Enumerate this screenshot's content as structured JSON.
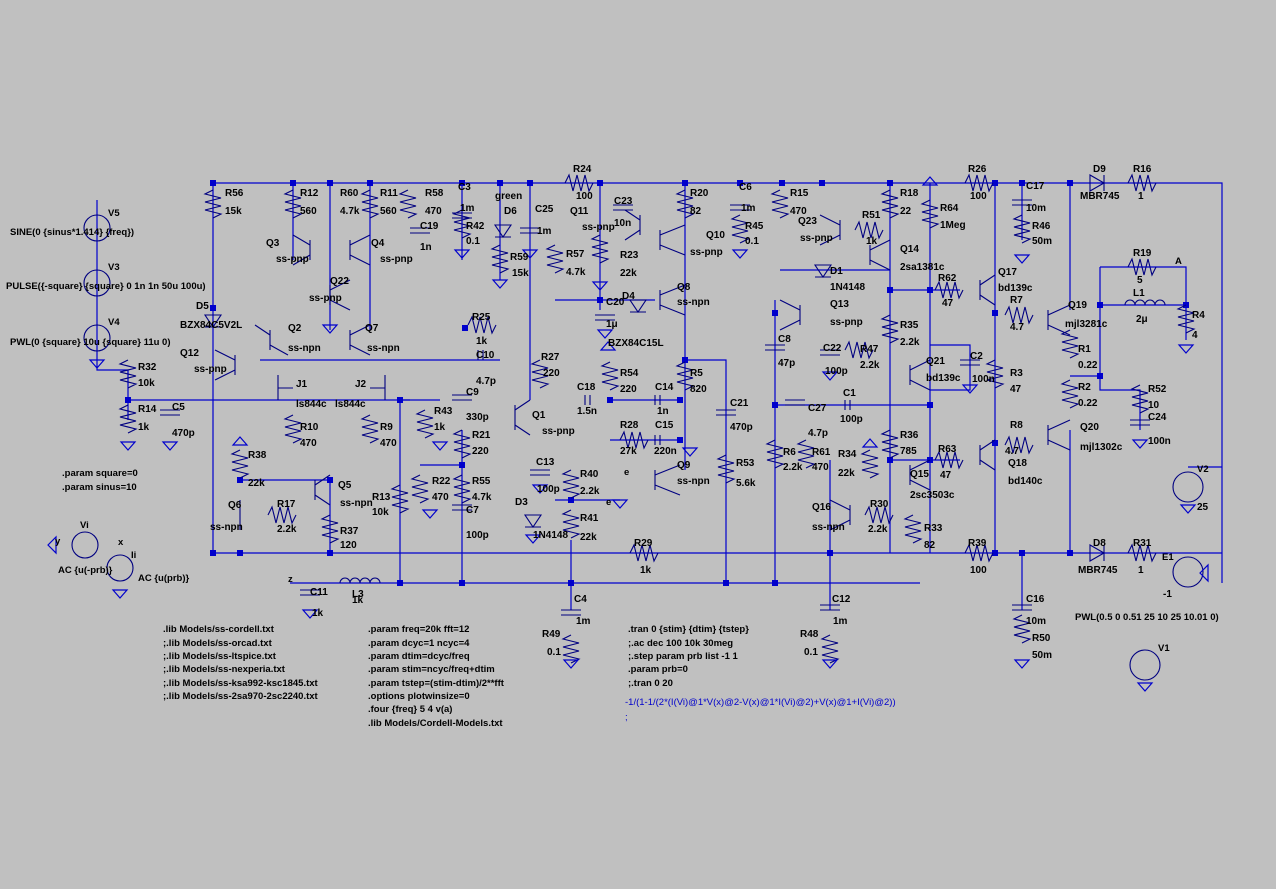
{
  "labels": [
    {
      "id": "R56",
      "v": "15k"
    },
    {
      "id": "R12",
      "v": "560"
    },
    {
      "id": "R60",
      "v": "4.7k"
    },
    {
      "id": "R11",
      "v": "560"
    },
    {
      "id": "R58",
      "v": "470"
    },
    {
      "id": "C3",
      "v": "1m"
    },
    {
      "id": "R42",
      "v": "0.1"
    },
    {
      "id": "R24",
      "v": "100"
    },
    {
      "id": "C23",
      "v": "10n"
    },
    {
      "id": "R20",
      "v": "82"
    },
    {
      "id": "C6",
      "v": "1m"
    },
    {
      "id": "R45",
      "v": "0.1"
    },
    {
      "id": "R15",
      "v": "470"
    },
    {
      "id": "R18",
      "v": "22"
    },
    {
      "id": "R64",
      "v": "1Meg"
    },
    {
      "id": "R26",
      "v": "100"
    },
    {
      "id": "C17",
      "v": "10m"
    },
    {
      "id": "R46",
      "v": "50m"
    },
    {
      "id": "D9",
      "v": "MBR745"
    },
    {
      "id": "R16",
      "v": "1"
    },
    {
      "id": "C19",
      "v": "1n"
    },
    {
      "id": "C25",
      "v": "1m"
    },
    {
      "id": "R59",
      "v": "15k"
    },
    {
      "id": "R57",
      "v": "4.7k"
    },
    {
      "id": "R23",
      "v": "22k"
    },
    {
      "id": "R51",
      "v": "1k"
    },
    {
      "id": "R19",
      "v": "5"
    },
    {
      "id": "R62",
      "v": "47"
    },
    {
      "id": "R7",
      "v": "4.7"
    },
    {
      "id": "L1",
      "v": "2μ"
    },
    {
      "id": "R4",
      "v": "4"
    },
    {
      "id": "C20",
      "v": "1μ"
    },
    {
      "id": "R25",
      "v": "1k"
    },
    {
      "id": "C10",
      "v": "4.7p"
    },
    {
      "id": "R27",
      "v": "220"
    },
    {
      "id": "R54",
      "v": "220"
    },
    {
      "id": "R5",
      "v": "820"
    },
    {
      "id": "C8",
      "v": "47p"
    },
    {
      "id": "C22",
      "v": "100p"
    },
    {
      "id": "R47",
      "v": "2.2k"
    },
    {
      "id": "R35",
      "v": "2.2k"
    },
    {
      "id": "C2",
      "v": "100n"
    },
    {
      "id": "R3",
      "v": "47"
    },
    {
      "id": "R1",
      "v": "0.22"
    },
    {
      "id": "R2",
      "v": "0.22"
    },
    {
      "id": "R52",
      "v": "10"
    },
    {
      "id": "C24",
      "v": "100n"
    },
    {
      "id": "R32",
      "v": "10k"
    },
    {
      "id": "R14",
      "v": "1k"
    },
    {
      "id": "C5",
      "v": "470p"
    },
    {
      "id": "R10",
      "v": "470"
    },
    {
      "id": "R9",
      "v": "470"
    },
    {
      "id": "R43",
      "v": "1k"
    },
    {
      "id": "C9",
      "v": "330p"
    },
    {
      "id": "R21",
      "v": "220"
    },
    {
      "id": "C18",
      "v": "1.5n"
    },
    {
      "id": "C14",
      "v": "1n"
    },
    {
      "id": "R28",
      "v": "27k"
    },
    {
      "id": "C15",
      "v": "220n"
    },
    {
      "id": "C21",
      "v": "470p"
    },
    {
      "id": "C27",
      "v": "4.7p"
    },
    {
      "id": "C1",
      "v": "100p"
    },
    {
      "id": "R6",
      "v": "2.2k"
    },
    {
      "id": "R61",
      "v": "470"
    },
    {
      "id": "R36",
      "v": "785"
    },
    {
      "id": "R63",
      "v": "47"
    },
    {
      "id": "R8",
      "v": "4.7"
    },
    {
      "id": "R38",
      "v": "22k"
    },
    {
      "id": "R17",
      "v": "2.2k"
    },
    {
      "id": "R37",
      "v": "120"
    },
    {
      "id": "R22",
      "v": "470"
    },
    {
      "id": "R55",
      "v": "4.7k"
    },
    {
      "id": "C7",
      "v": "100p"
    },
    {
      "id": "C13",
      "v": "100p"
    },
    {
      "id": "R40",
      "v": "2.2k"
    },
    {
      "id": "R41",
      "v": "22k"
    },
    {
      "id": "R53",
      "v": "5.6k"
    },
    {
      "id": "R34",
      "v": "22k"
    },
    {
      "id": "R30",
      "v": "2.2k"
    },
    {
      "id": "R33",
      "v": "82"
    },
    {
      "id": "R13",
      "v": "10k"
    },
    {
      "id": "R29",
      "v": "1k"
    },
    {
      "id": "R39",
      "v": "100"
    },
    {
      "id": "D8",
      "v": "MBR745"
    },
    {
      "id": "R31",
      "v": "1"
    },
    {
      "id": "C11",
      "v": "1k"
    },
    {
      "id": "L3",
      "v": "1k"
    },
    {
      "id": "C4",
      "v": "1m"
    },
    {
      "id": "R49",
      "v": "0.1"
    },
    {
      "id": "C12",
      "v": "1m"
    },
    {
      "id": "R48",
      "v": "0.1"
    },
    {
      "id": "C16",
      "v": "10m"
    },
    {
      "id": "R50",
      "v": "50m"
    }
  ],
  "extra": {
    "Q3": "ss-pnp",
    "Q4": "ss-pnp",
    "Q22": "ss-pnp",
    "Q2": "ss-npn",
    "Q7": "ss-npn",
    "Q12": "ss-pnp",
    "J1": "ls844c",
    "J2": "ls844c",
    "Q1": "ss-pnp",
    "Q11": "ss-pnp",
    "Q10": "ss-pnp",
    "Q8": "ss-npn",
    "Q9": "ss-npn",
    "Q23": "ss-pnp",
    "Q13": "ss-pnp",
    "Q14": "2sa1381c",
    "Q21": "bd139c",
    "Q17": "bd139c",
    "Q19": "mjl3281c",
    "Q20": "mjl1302c",
    "Q18": "bd140c",
    "Q15": "2sc3503c",
    "Q16": "ss-npn",
    "Q6": "ss-npn",
    "Q5": "ss-npn",
    "D5": "BZX84C5V2L",
    "D4": "BZX84C15L",
    "D1": "1N4148",
    "D3": "1N4148",
    "D6": "green",
    "V2": "25",
    "E1": "-1"
  },
  "sources": {
    "v5": "SINE(0 {sinus*1.414} {freq})",
    "v3": "PULSE({-square} {square} 0 1n 1n 50u 100u)",
    "v4": "PWL(0 {square} 10u {square} 11u 0)",
    "vi_ac": "AC {u(-prb)}",
    "ii_ac": "AC {u(prb)}",
    "e1_pwl": "PWL(0.5 0 0.51 25 10 25 10.01 0)"
  },
  "params": {
    "p1": ".param square=0",
    "p2": ".param sinus=10"
  },
  "libs": [
    ".lib Models/ss-cordell.txt",
    ";.lib Models/ss-orcad.txt",
    ";.lib Models/ss-ltspice.txt",
    ";.lib Models/ss-nexperia.txt",
    ";.lib Models/ss-ksa992-ksc1845.txt",
    ";.lib Models/ss-2sa970-2sc2240.txt"
  ],
  "params2": [
    ".param freq=20k fft=12",
    ".param dcyc=1 ncyc=4",
    ".param dtim=dcyc/freq",
    ".param stim=ncyc/freq+dtim",
    ".param tstep=(stim-dtim)/2**fft",
    ".options plotwinsize=0",
    ".four {freq} 5 4 v(a)",
    ".lib Models/Cordell-Models.txt"
  ],
  "sim": [
    ".tran 0 {stim} {dtim} {tstep}",
    ";.ac dec 100 10k 30meg",
    ";.step param prb list -1 1",
    ".param prb=0",
    ";.tran 0 20"
  ],
  "meas": "-1/(1-1/(2*(I(Vi)@1*V(x)@2-V(x)@1*I(Vi)@2)+V(x)@1+I(Vi)@2))",
  "meas2": ";",
  "nets": {
    "y": "y",
    "x": "x",
    "z": "z",
    "a": "A",
    "e1": "e",
    "e2": "e",
    "Vi": "Vi",
    "Ii": "Ii",
    "V5": "V5",
    "V3": "V3",
    "V4": "V4",
    "V1": "V1",
    "V2": "V2",
    "E1": "E1"
  }
}
